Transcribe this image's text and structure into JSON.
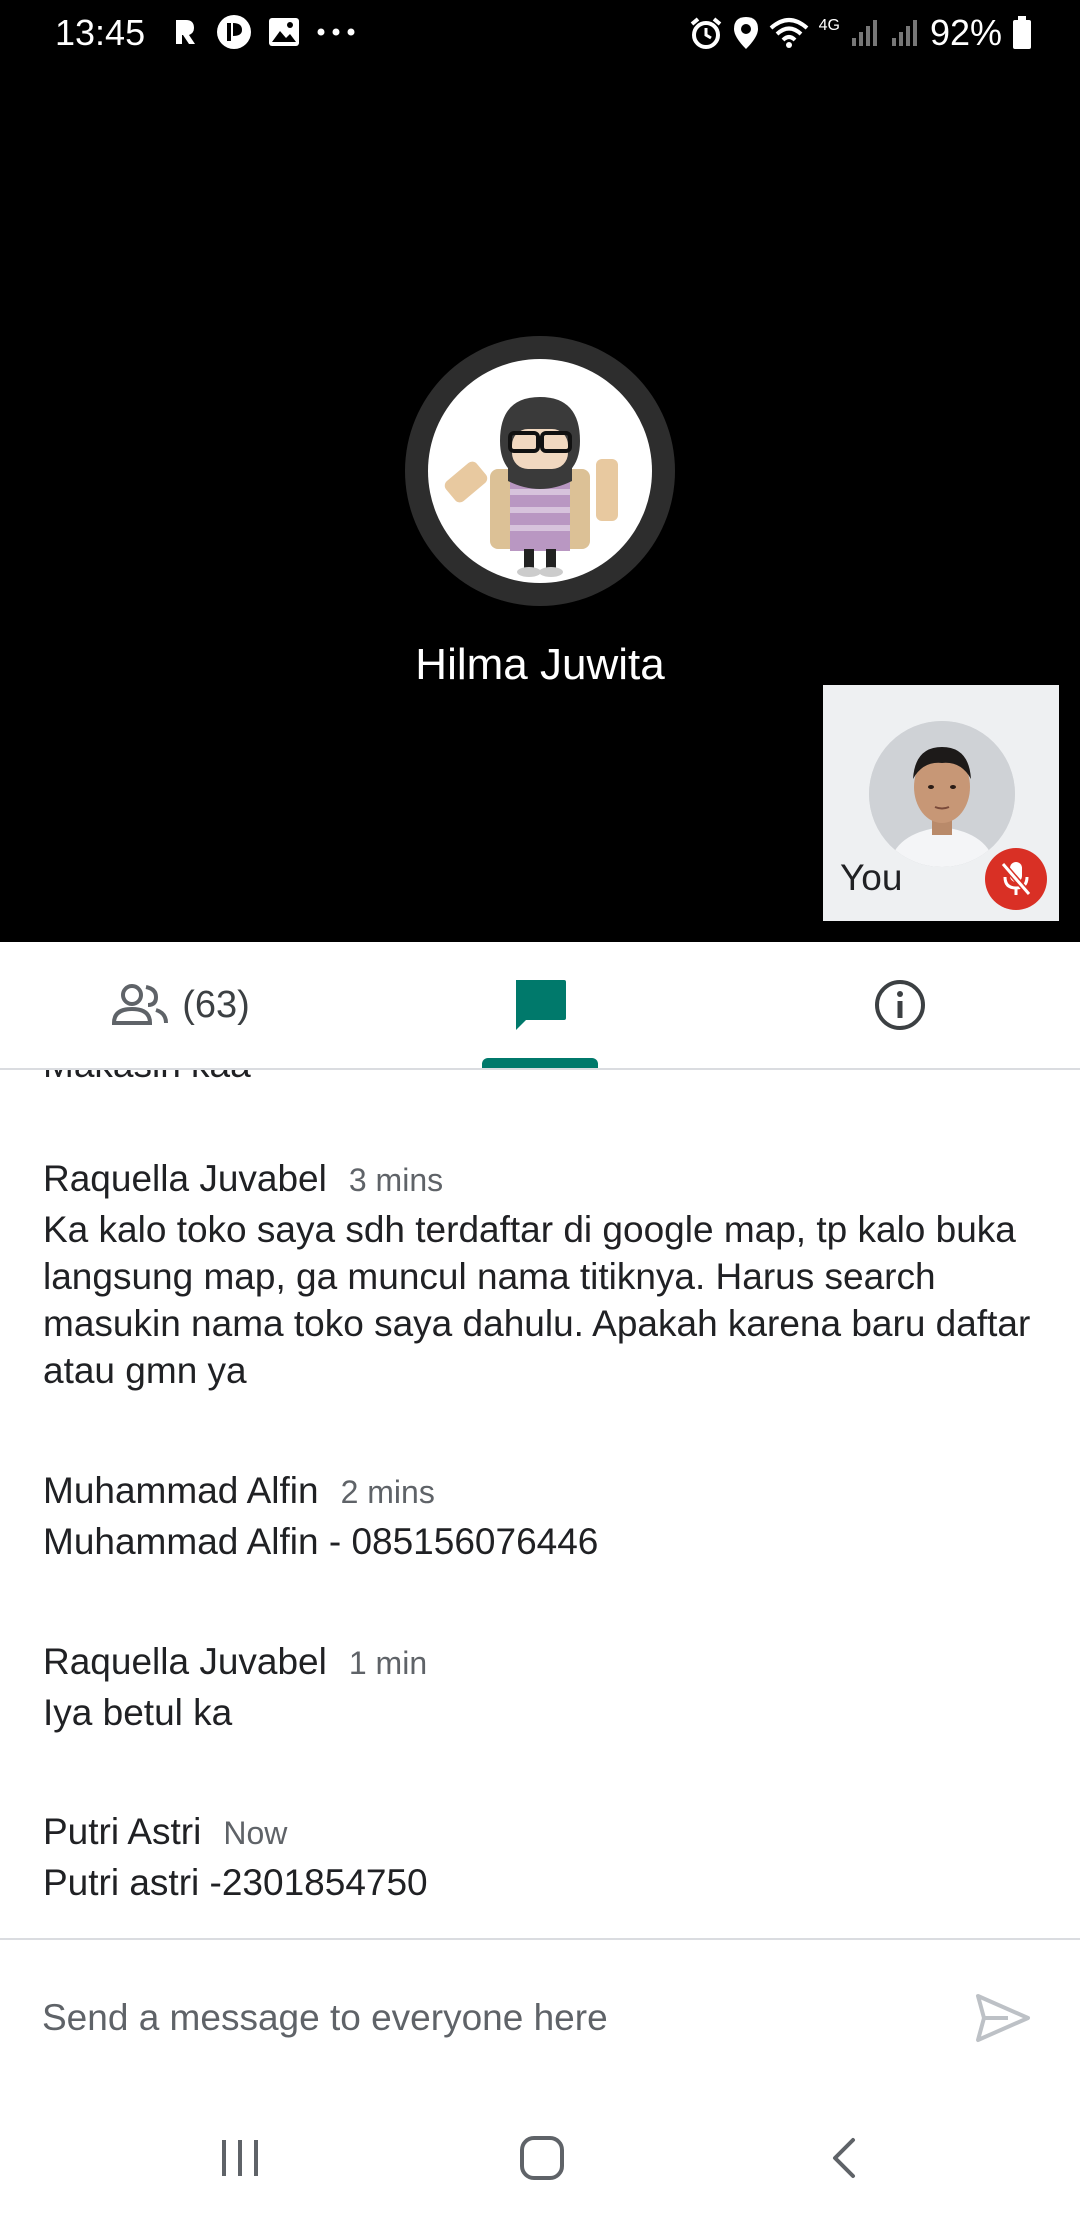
{
  "status_bar": {
    "time": "13:45",
    "battery": "92%",
    "network": "4G"
  },
  "call": {
    "speaker_name": "Hilma Juwita",
    "self_label": "You"
  },
  "tabs": {
    "people_count": "(63)"
  },
  "messages": {
    "cut_off_text": "Makasih kaa",
    "items": [
      {
        "sender": "Raquella Juvabel",
        "time": "3 mins",
        "text": "Ka kalo toko saya sdh terdaftar di google map, tp kalo buka langsung map, ga muncul nama titiknya. Harus search masukin nama toko saya dahulu. Apakah karena baru daftar atau gmn ya"
      },
      {
        "sender": "Muhammad Alfin",
        "time": "2 mins",
        "text": "Muhammad Alfin - 085156076446"
      },
      {
        "sender": "Raquella Juvabel",
        "time": "1 min",
        "text": "Iya betul ka"
      },
      {
        "sender": "Putri Astri",
        "time": "Now",
        "text": "Putri astri -2301854750"
      }
    ]
  },
  "composer": {
    "placeholder": "Send a message to everyone here"
  },
  "colors": {
    "accent": "#00796b",
    "mute": "#d93025",
    "call_background": "#000000"
  }
}
